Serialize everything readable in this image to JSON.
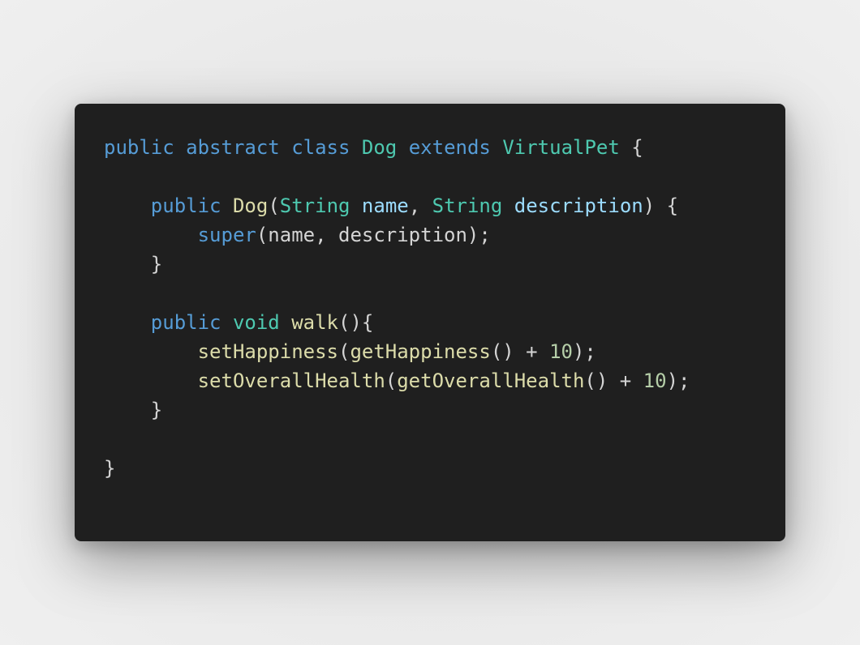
{
  "code": {
    "language": "java",
    "lines": [
      [
        {
          "text": "public",
          "kind": "kw"
        },
        {
          "text": " ",
          "kind": "pun"
        },
        {
          "text": "abstract",
          "kind": "kw"
        },
        {
          "text": " ",
          "kind": "pun"
        },
        {
          "text": "class",
          "kind": "kw"
        },
        {
          "text": " ",
          "kind": "pun"
        },
        {
          "text": "Dog",
          "kind": "type"
        },
        {
          "text": " ",
          "kind": "pun"
        },
        {
          "text": "extends",
          "kind": "kw"
        },
        {
          "text": " ",
          "kind": "pun"
        },
        {
          "text": "VirtualPet",
          "kind": "type"
        },
        {
          "text": " {",
          "kind": "pun"
        }
      ],
      [],
      [
        {
          "text": "    ",
          "kind": "pun"
        },
        {
          "text": "public",
          "kind": "kw"
        },
        {
          "text": " ",
          "kind": "pun"
        },
        {
          "text": "Dog",
          "kind": "fn"
        },
        {
          "text": "(",
          "kind": "pun"
        },
        {
          "text": "String",
          "kind": "type"
        },
        {
          "text": " ",
          "kind": "pun"
        },
        {
          "text": "name",
          "kind": "var"
        },
        {
          "text": ", ",
          "kind": "pun"
        },
        {
          "text": "String",
          "kind": "type"
        },
        {
          "text": " ",
          "kind": "pun"
        },
        {
          "text": "description",
          "kind": "var"
        },
        {
          "text": ") {",
          "kind": "pun"
        }
      ],
      [
        {
          "text": "        ",
          "kind": "pun"
        },
        {
          "text": "super",
          "kind": "kw"
        },
        {
          "text": "(name, description);",
          "kind": "pun"
        }
      ],
      [
        {
          "text": "    }",
          "kind": "pun"
        }
      ],
      [],
      [
        {
          "text": "    ",
          "kind": "pun"
        },
        {
          "text": "public",
          "kind": "kw"
        },
        {
          "text": " ",
          "kind": "pun"
        },
        {
          "text": "void",
          "kind": "type"
        },
        {
          "text": " ",
          "kind": "pun"
        },
        {
          "text": "walk",
          "kind": "fn"
        },
        {
          "text": "(){",
          "kind": "pun"
        }
      ],
      [
        {
          "text": "        ",
          "kind": "pun"
        },
        {
          "text": "setHappiness",
          "kind": "fn"
        },
        {
          "text": "(",
          "kind": "pun"
        },
        {
          "text": "getHappiness",
          "kind": "fn"
        },
        {
          "text": "() + ",
          "kind": "pun"
        },
        {
          "text": "10",
          "kind": "num"
        },
        {
          "text": ");",
          "kind": "pun"
        }
      ],
      [
        {
          "text": "        ",
          "kind": "pun"
        },
        {
          "text": "setOverallHealth",
          "kind": "fn"
        },
        {
          "text": "(",
          "kind": "pun"
        },
        {
          "text": "getOverallHealth",
          "kind": "fn"
        },
        {
          "text": "() + ",
          "kind": "pun"
        },
        {
          "text": "10",
          "kind": "num"
        },
        {
          "text": ");",
          "kind": "pun"
        }
      ],
      [
        {
          "text": "    }",
          "kind": "pun"
        }
      ],
      [],
      [
        {
          "text": "}",
          "kind": "pun"
        }
      ]
    ]
  },
  "theme": {
    "background": "#1f1f1f",
    "page_background": "#e9e9e9",
    "keyword": "#569cd6",
    "type": "#4ec9b0",
    "function": "#dcdcaa",
    "variable": "#9cdcfe",
    "number": "#b5cea8",
    "punctuation": "#d4d4d4"
  }
}
